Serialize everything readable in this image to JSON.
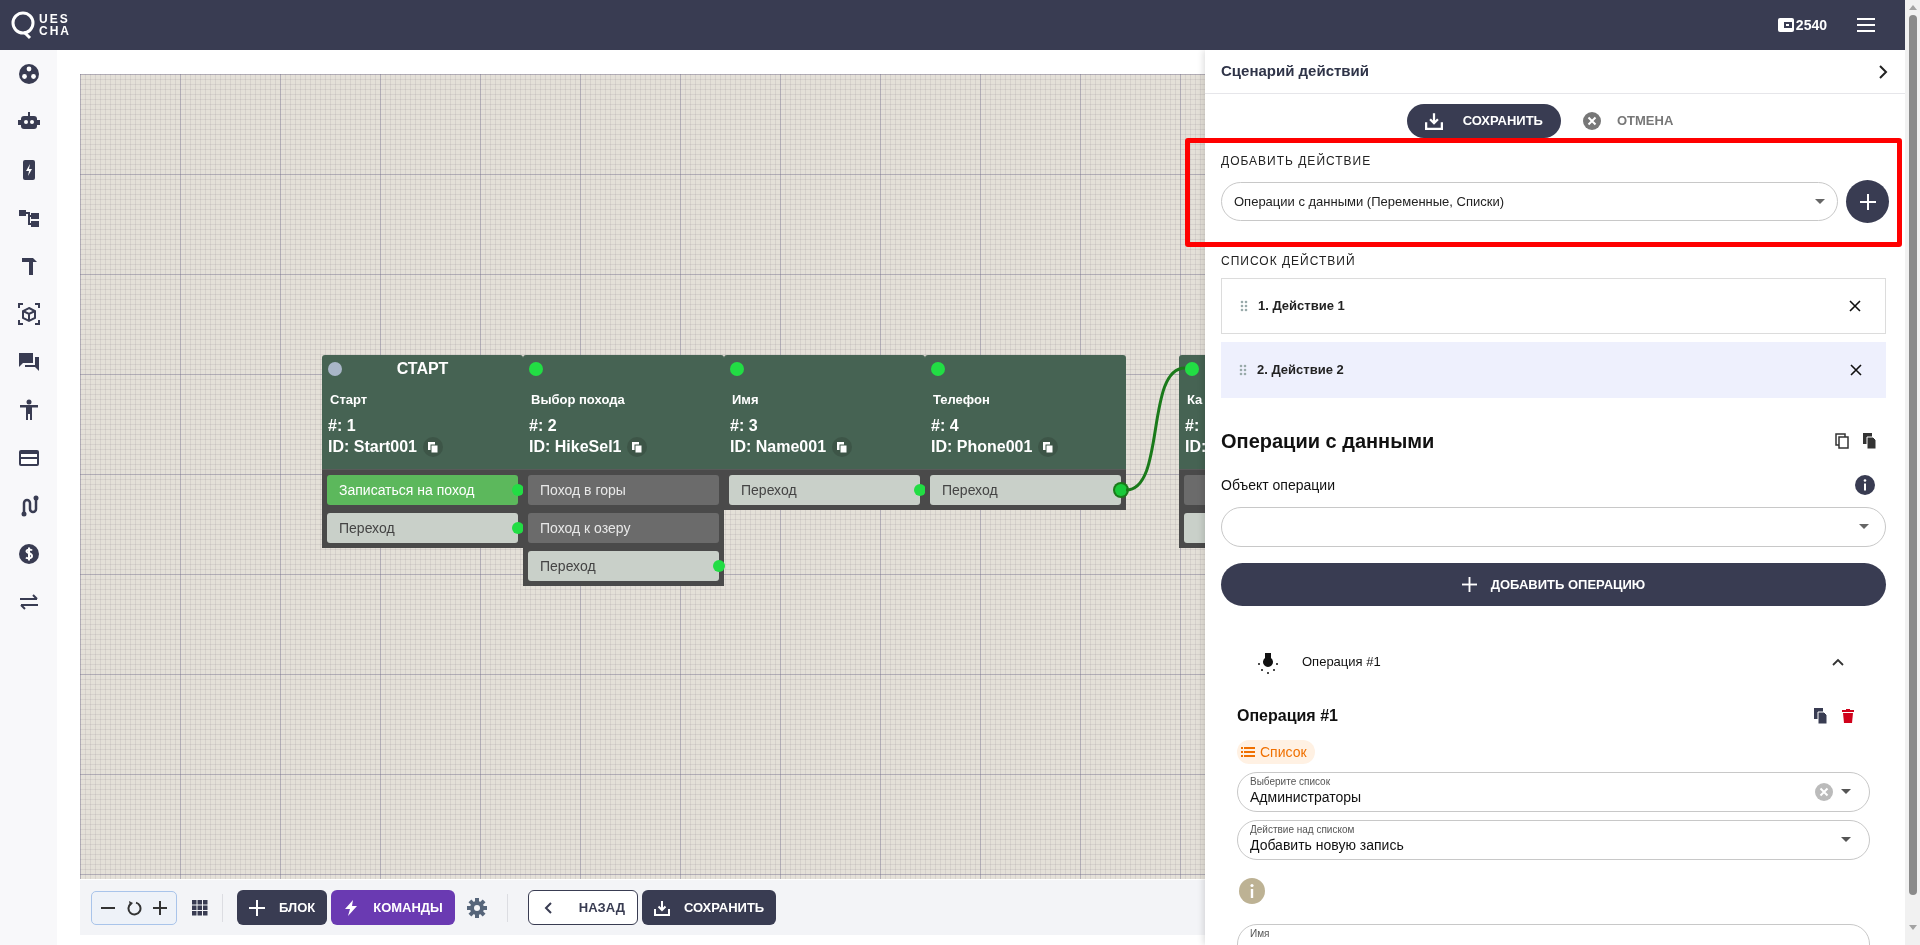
{
  "header": {
    "logo_lines": [
      "UES",
      "CHA"
    ],
    "balance": "2540"
  },
  "canvas": {
    "nodes": [
      {
        "heading": "СТАРТ",
        "name": "Старт",
        "number": "#: 1",
        "id": "ID: Start001",
        "input_connected": false,
        "outputs": [
          {
            "label": "Записаться на поход",
            "kind": "primary",
            "connected": false
          },
          {
            "label": "Переход",
            "kind": "transition",
            "connected": false
          }
        ]
      },
      {
        "name": "Выбор похода",
        "number": "#: 2",
        "id": "ID: HikeSel1",
        "input_connected": true,
        "outputs": [
          {
            "label": "Поход в горы",
            "kind": "option",
            "connected": false
          },
          {
            "label": "Поход к озеру",
            "kind": "option",
            "connected": false
          },
          {
            "label": "Переход",
            "kind": "transition",
            "connected": false
          }
        ]
      },
      {
        "name": "Имя",
        "number": "#: 3",
        "id": "ID: Name001",
        "input_connected": true,
        "outputs": [
          {
            "label": "Переход",
            "kind": "transition",
            "connected": false
          }
        ]
      },
      {
        "name": "Телефон",
        "number": "#: 4",
        "id": "ID: Phone001",
        "input_connected": true,
        "outputs": [
          {
            "label": "Переход",
            "kind": "transition",
            "connected": true
          }
        ]
      },
      {
        "name": "Ка",
        "number": "#:",
        "id": "ID:",
        "input_connected": true,
        "outputs": [
          {
            "kind": "option"
          },
          {
            "kind": "transition"
          }
        ]
      }
    ]
  },
  "toolbar": {
    "block": "БЛОК",
    "commands": "КОМАНДЫ",
    "back": "НАЗАД",
    "save": "СОХРАНИТЬ"
  },
  "panel": {
    "title": "Сценарий действий",
    "save_label": "СОХРАНИТЬ",
    "cancel_label": "ОТМЕНА",
    "add_action": {
      "label": "ДОБАВИТЬ ДЕЙСТВИЕ",
      "value": "Операции с данными (Переменные, Списки)",
      "highlighted": true
    },
    "actions_label": "СПИСОК ДЕЙСТВИЙ",
    "actions": [
      {
        "label": "1. Действие 1",
        "selected": false
      },
      {
        "label": "2. Действие 2",
        "selected": true
      }
    ],
    "section_title": "Операции с данными",
    "object_label": "Объект операции",
    "add_operation": "ДОБАВИТЬ ОПЕРАЦИЮ",
    "operation": {
      "header": "Операция #1",
      "expanded": true,
      "title": "Операция #1",
      "chip": "Список",
      "fields": [
        {
          "label": "Выберите список",
          "value": "Администраторы",
          "clearable": true
        },
        {
          "label": "Действие над списком",
          "value": "Добавить новую запись",
          "clearable": false
        },
        {
          "label": "Имя"
        }
      ]
    }
  }
}
